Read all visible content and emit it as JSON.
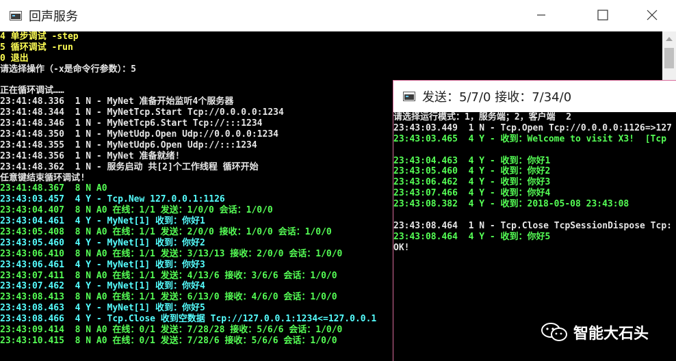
{
  "main_window": {
    "title": "回声服务",
    "lines": [
      {
        "text": "4 单步调试 -step",
        "color": "#ffff55"
      },
      {
        "text": "5 循环调试 -run",
        "color": "#ffff55"
      },
      {
        "text": "0 退出",
        "color": "#ffff55"
      },
      {
        "text": "请选择操作（-x是命令行参数）：5",
        "color": "#e6e6e6"
      },
      {
        "text": "",
        "color": "#e6e6e6"
      },
      {
        "text": "正在循环调试……",
        "color": "#e6e6e6"
      },
      {
        "text": "23:41:48.336  1 N - MyNet 准备开始监听4个服务器",
        "color": "#e6e6e6"
      },
      {
        "text": "23:41:48.344  1 N - MyNetTcp.Start Tcp://0.0.0.0:1234",
        "color": "#e6e6e6"
      },
      {
        "text": "23:41:48.346  1 N - MyNetTcp6.Start Tcp://:::1234",
        "color": "#e6e6e6"
      },
      {
        "text": "23:41:48.350  1 N - MyNetUdp.Open Udp://0.0.0.0:1234",
        "color": "#e6e6e6"
      },
      {
        "text": "23:41:48.355  1 N - MyNetUdp6.Open Udp://:::1234",
        "color": "#e6e6e6"
      },
      {
        "text": "23:41:48.356  1 N - MyNet 准备就绪!",
        "color": "#e6e6e6"
      },
      {
        "text": "23:41:48.362  1 N - 服务启动 共[2]个工作线程 循环开始",
        "color": "#e6e6e6"
      },
      {
        "text": "任意键结束循环调试!",
        "color": "#e6e6e6"
      },
      {
        "text": "23:41:48.367  8 N A0",
        "color": "#55ff55"
      },
      {
        "text": "23:43:03.457  4 Y - Tcp.New 127.0.0.1:1126",
        "color": "#55ffff"
      },
      {
        "text": "23:43:04.407  8 N A0 在线：1/1 发送：1/0/0 会话：1/0/0",
        "color": "#55ff55"
      },
      {
        "text": "23:43:04.461  4 Y - MyNet[1] 收到：你好1",
        "color": "#55ffff"
      },
      {
        "text": "23:43:05.408  8 N A0 在线：1/1 发送：2/0/0 接收：1/0/0 会话：1/0/0",
        "color": "#55ff55"
      },
      {
        "text": "23:43:05.460  4 Y - MyNet[1] 收到：你好2",
        "color": "#55ffff"
      },
      {
        "text": "23:43:06.410  8 N A0 在线：1/1 发送：3/13/13 接收：2/0/0 会话：1/0/0",
        "color": "#55ff55"
      },
      {
        "text": "23:43:06.461  4 Y - MyNet[1] 收到：你好3",
        "color": "#55ffff"
      },
      {
        "text": "23:43:07.411  8 N A0 在线：1/1 发送：4/13/6 接收：3/6/6 会话：1/0/0",
        "color": "#55ff55"
      },
      {
        "text": "23:43:07.462  4 Y - MyNet[1] 收到：你好4",
        "color": "#55ffff"
      },
      {
        "text": "23:43:08.413  8 N A0 在线：1/1 发送：6/13/0 接收：4/6/0 会话：1/0/0",
        "color": "#55ff55"
      },
      {
        "text": "23:43:08.463  4 Y - MyNet[1] 收到：你好5",
        "color": "#55ffff"
      },
      {
        "text": "23:43:08.466  4 Y - Tcp.Close 收到空数据 Tcp://127.0.0.1:1234<=127.0.0.1",
        "color": "#55ffff"
      },
      {
        "text": "23:43:09.414  8 N A0 在线：0/1 发送：7/28/28 接收：5/6/6 会话：1/0/0",
        "color": "#55ff55"
      },
      {
        "text": "23:43:10.415  8 N A0 在线：0/1 发送：7/28/6 接收：5/6/6 会话：1/0/0",
        "color": "#55ff55"
      }
    ]
  },
  "client_window": {
    "title": "发送：5/7/0 接收：7/34/0",
    "lines": [
      {
        "text": "请选择运行模式：1，服务端；2，客户端  2",
        "color": "#e6e6e6"
      },
      {
        "text": "23:43:03.449  1 N - Tcp.Open Tcp://0.0.0.0:1126=>127",
        "color": "#e6e6e6"
      },
      {
        "text": "23:43:03.465  4 Y - 收到：Welcome to visit X3!  [Tcp",
        "color": "#55ff55"
      },
      {
        "text": "",
        "color": "#e6e6e6"
      },
      {
        "text": "23:43:04.463  4 Y - 收到：你好1",
        "color": "#55ff55"
      },
      {
        "text": "23:43:05.460  4 Y - 收到：你好2",
        "color": "#55ff55"
      },
      {
        "text": "23:43:06.462  4 Y - 收到：你好3",
        "color": "#55ff55"
      },
      {
        "text": "23:43:07.466  4 Y - 收到：你好4",
        "color": "#55ff55"
      },
      {
        "text": "23:43:08.382  4 Y - 收到：2018-05-08 23:43:08",
        "color": "#55ff55"
      },
      {
        "text": "",
        "color": "#e6e6e6"
      },
      {
        "text": "23:43:08.464  1 N - Tcp.Close TcpSessionDispose Tcp:",
        "color": "#e6e6e6"
      },
      {
        "text": "23:43:08.464  4 Y - 收到：你好5",
        "color": "#55ff55"
      },
      {
        "text": "OK!",
        "color": "#e6e6e6"
      }
    ]
  },
  "watermark": {
    "text": "智能大石头",
    "icon": "wechat-icon"
  },
  "icons": {
    "app": "console-app-icon",
    "minimize": "minimize-icon",
    "maximize": "maximize-icon",
    "close": "close-icon",
    "scroll_up": "scroll-up-arrow-icon"
  }
}
